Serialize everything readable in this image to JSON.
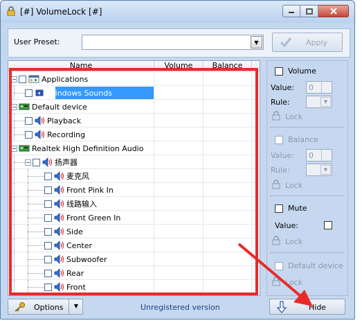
{
  "window": {
    "title": "[#] VolumeLock [#]"
  },
  "preset": {
    "label": "User Preset:",
    "value": "",
    "apply_label": "Apply"
  },
  "columns": [
    "Name",
    "Volume",
    "Balance"
  ],
  "tree": [
    {
      "label": "Applications",
      "level": 0,
      "kind": "app-group",
      "expander": "-",
      "checkbox": true
    },
    {
      "label": "Windows Sounds",
      "level": 1,
      "kind": "app",
      "selected": true,
      "checkbox": true
    },
    {
      "label": "Default device",
      "level": 0,
      "kind": "device",
      "expander": "-",
      "checkbox": false
    },
    {
      "label": "Playback",
      "level": 1,
      "kind": "speaker",
      "checkbox": true
    },
    {
      "label": "Recording",
      "level": 1,
      "kind": "speaker",
      "checkbox": true
    },
    {
      "label": "Realtek High Definition Audio",
      "level": 0,
      "kind": "device",
      "expander": "-",
      "checkbox": false
    },
    {
      "label": "扬声器",
      "level": 1,
      "kind": "speaker",
      "expander": "-",
      "checkbox": true
    },
    {
      "label": "麦克风",
      "level": 2,
      "kind": "speaker",
      "checkbox": true
    },
    {
      "label": "Front Pink In",
      "level": 2,
      "kind": "speaker",
      "checkbox": true
    },
    {
      "label": "线路输入",
      "level": 2,
      "kind": "speaker",
      "checkbox": true
    },
    {
      "label": "Front Green In",
      "level": 2,
      "kind": "speaker",
      "checkbox": true
    },
    {
      "label": "Side",
      "level": 2,
      "kind": "speaker",
      "checkbox": true
    },
    {
      "label": "Center",
      "level": 2,
      "kind": "speaker",
      "checkbox": true
    },
    {
      "label": "Subwoofer",
      "level": 2,
      "kind": "speaker",
      "checkbox": true
    },
    {
      "label": "Rear",
      "level": 2,
      "kind": "speaker",
      "checkbox": true
    },
    {
      "label": "Front",
      "level": 2,
      "kind": "speaker",
      "checkbox": true
    }
  ],
  "side": {
    "volume_label": "Volume",
    "value_label": "Value:",
    "value": "0",
    "rule_label": "Rule:",
    "lock_label": "Lock",
    "balance_label": "Balance",
    "balance_value_label": "Value:",
    "balance_value": "0",
    "balance_rule_label": "Rule:",
    "balance_lock_label": "Lock",
    "mute_label": "Mute",
    "mute_value_label": "Value:",
    "mute_lock_label": "Lock",
    "default_device_label": "Default device",
    "default_lock_label": "Lock"
  },
  "bottom": {
    "options_label": "Options",
    "status": "Unregistered version",
    "hide_label": "Hide"
  },
  "colors": {
    "selection": "#3399ff",
    "annotation": "#ea2a2a",
    "status_text": "#1b3f8a"
  }
}
